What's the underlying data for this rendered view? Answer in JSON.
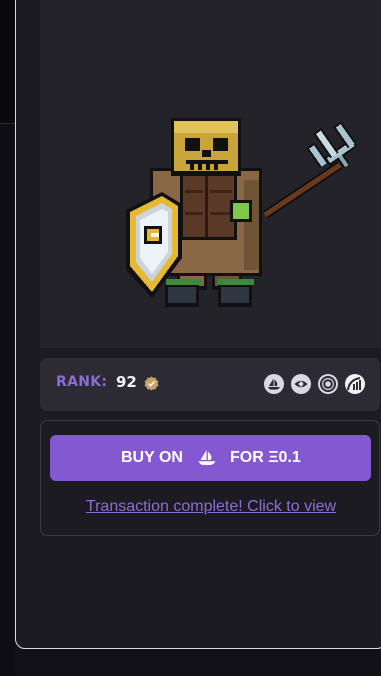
{
  "nft": {
    "rank_label": "RANK:",
    "rank_value": "92",
    "image_subject": "pixel-art skeleton knight with shield and trident"
  },
  "marketplaces": [
    {
      "icon": "opensea-boat-icon"
    },
    {
      "icon": "looksrare-eye-icon"
    },
    {
      "icon": "x2y2-rings-icon"
    },
    {
      "icon": "gem-chart-icon"
    }
  ],
  "buy": {
    "prefix": "BUY ON",
    "platform_icon": "opensea-boat-icon",
    "price": "FOR Ξ0.1",
    "status_link": "Transaction complete! Click to view"
  },
  "colors": {
    "accent": "#8358d0",
    "link": "#8f6bd6",
    "panel": "#1c1b22",
    "card": "#2c2b33"
  }
}
